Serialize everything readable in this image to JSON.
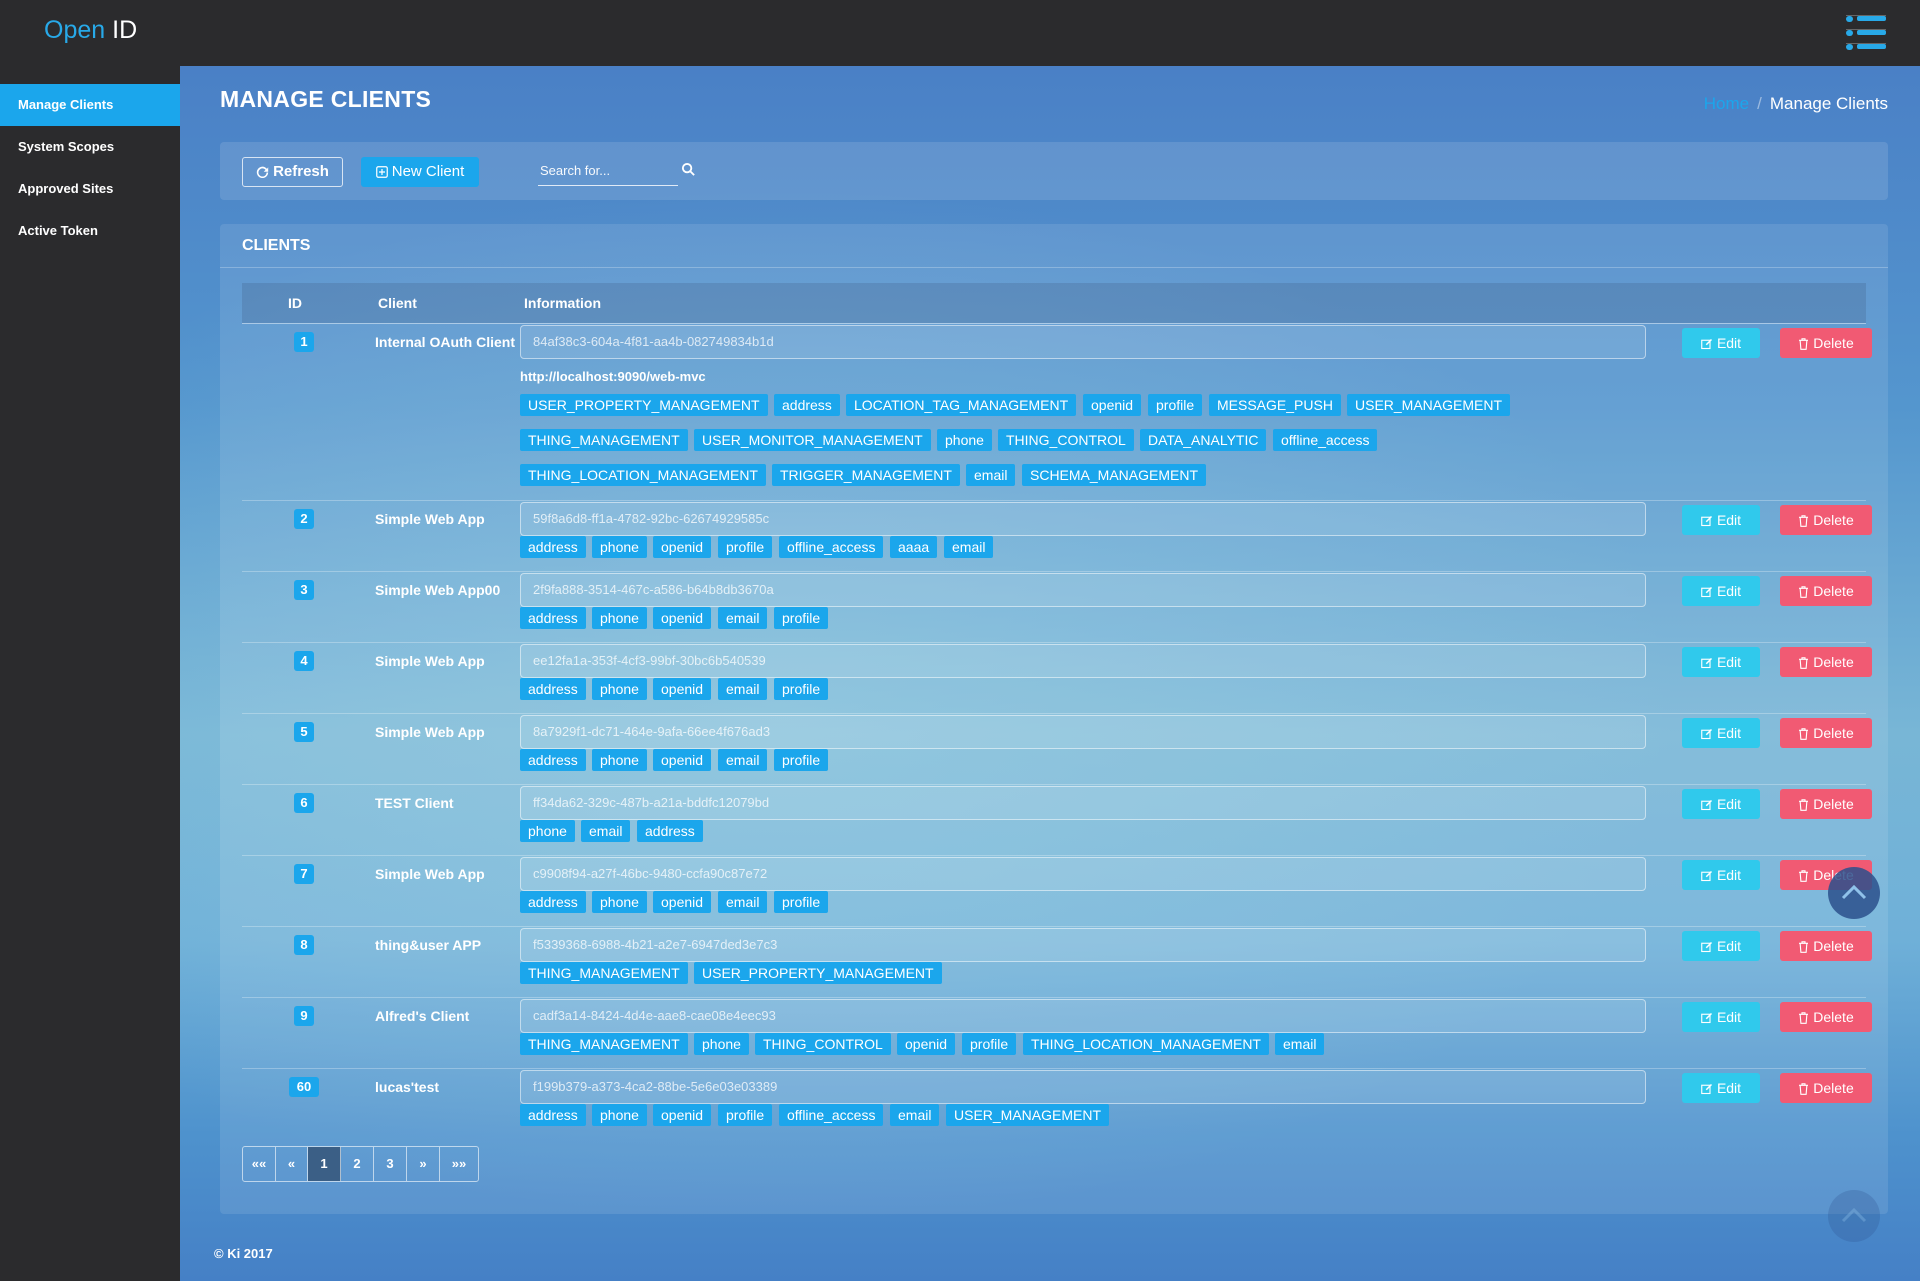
{
  "brand": {
    "part1": "Open",
    "part2": "ID"
  },
  "sidebar": {
    "items": [
      {
        "label": "Manage Clients",
        "active": true
      },
      {
        "label": "System Scopes",
        "active": false
      },
      {
        "label": "Approved Sites",
        "active": false
      },
      {
        "label": "Active Token",
        "active": false
      }
    ]
  },
  "page": {
    "title": "MANAGE CLIENTS"
  },
  "breadcrumb": {
    "home": "Home",
    "separator": "/",
    "current": "Manage Clients"
  },
  "toolbar": {
    "refresh_label": "Refresh",
    "new_client_label": "New Client",
    "search_placeholder": "Search for..."
  },
  "clients_panel": {
    "title": "CLIENTS",
    "columns": {
      "id": "ID",
      "client": "Client",
      "information": "Information"
    },
    "edit_label": "Edit",
    "delete_label": "Delete"
  },
  "clients": [
    {
      "id": "1",
      "name": "Internal OAuth Client",
      "client_id": "84af38c3-604a-4f81-aa4b-082749834b1d",
      "redirect": "http://localhost:9090/web-mvc",
      "scopes": [
        "USER_PROPERTY_MANAGEMENT",
        "address",
        "LOCATION_TAG_MANAGEMENT",
        "openid",
        "profile",
        "MESSAGE_PUSH",
        "USER_MANAGEMENT",
        "THING_MANAGEMENT",
        "USER_MONITOR_MANAGEMENT",
        "phone",
        "THING_CONTROL",
        "DATA_ANALYTIC",
        "offline_access",
        "THING_LOCATION_MANAGEMENT",
        "TRIGGER_MANAGEMENT",
        "email",
        "SCHEMA_MANAGEMENT"
      ]
    },
    {
      "id": "2",
      "name": "Simple Web App",
      "client_id": "59f8a6d8-ff1a-4782-92bc-62674929585c",
      "scopes": [
        "address",
        "phone",
        "openid",
        "profile",
        "offline_access",
        "aaaa",
        "email"
      ]
    },
    {
      "id": "3",
      "name": "Simple Web App00",
      "client_id": "2f9fa888-3514-467c-a586-b64b8db3670a",
      "scopes": [
        "address",
        "phone",
        "openid",
        "email",
        "profile"
      ]
    },
    {
      "id": "4",
      "name": "Simple Web App",
      "client_id": "ee12fa1a-353f-4cf3-99bf-30bc6b540539",
      "scopes": [
        "address",
        "phone",
        "openid",
        "email",
        "profile"
      ]
    },
    {
      "id": "5",
      "name": "Simple Web App",
      "client_id": "8a7929f1-dc71-464e-9afa-66ee4f676ad3",
      "scopes": [
        "address",
        "phone",
        "openid",
        "email",
        "profile"
      ]
    },
    {
      "id": "6",
      "name": "TEST Client",
      "client_id": "ff34da62-329c-487b-a21a-bddfc12079bd",
      "scopes": [
        "phone",
        "email",
        "address"
      ]
    },
    {
      "id": "7",
      "name": "Simple Web App",
      "client_id": "c9908f94-a27f-46bc-9480-ccfa90c87e72",
      "scopes": [
        "address",
        "phone",
        "openid",
        "email",
        "profile"
      ]
    },
    {
      "id": "8",
      "name": "thing&user APP",
      "client_id": "f5339368-6988-4b21-a2e7-6947ded3e7c3",
      "scopes": [
        "THING_MANAGEMENT",
        "USER_PROPERTY_MANAGEMENT"
      ]
    },
    {
      "id": "9",
      "name": "Alfred's Client",
      "client_id": "cadf3a14-8424-4d4e-aae8-cae08e4eec93",
      "scopes": [
        "THING_MANAGEMENT",
        "phone",
        "THING_CONTROL",
        "openid",
        "profile",
        "THING_LOCATION_MANAGEMENT",
        "email"
      ]
    },
    {
      "id": "60",
      "name": "lucas'test",
      "client_id": "f199b379-a373-4ca2-88be-5e6e03e03389",
      "scopes": [
        "address",
        "phone",
        "openid",
        "profile",
        "offline_access",
        "email",
        "USER_MANAGEMENT"
      ]
    }
  ],
  "pagination": {
    "first": "««",
    "prev": "«",
    "pages": [
      "1",
      "2",
      "3"
    ],
    "current": "1",
    "next": "»",
    "last": "»»"
  },
  "footer": {
    "text": "© Ki 2017"
  },
  "colors": {
    "accent": "#1ba6ec",
    "edit": "#30c9ec",
    "delete": "#f15a73",
    "topbar": "#2b2b2d"
  },
  "icons": {
    "refresh": "refresh-icon",
    "new": "plus-square-icon",
    "search": "search-icon",
    "edit": "edit-icon",
    "delete": "trash-icon",
    "menu": "list-menu-icon",
    "scroll_top": "chevron-up-icon"
  }
}
